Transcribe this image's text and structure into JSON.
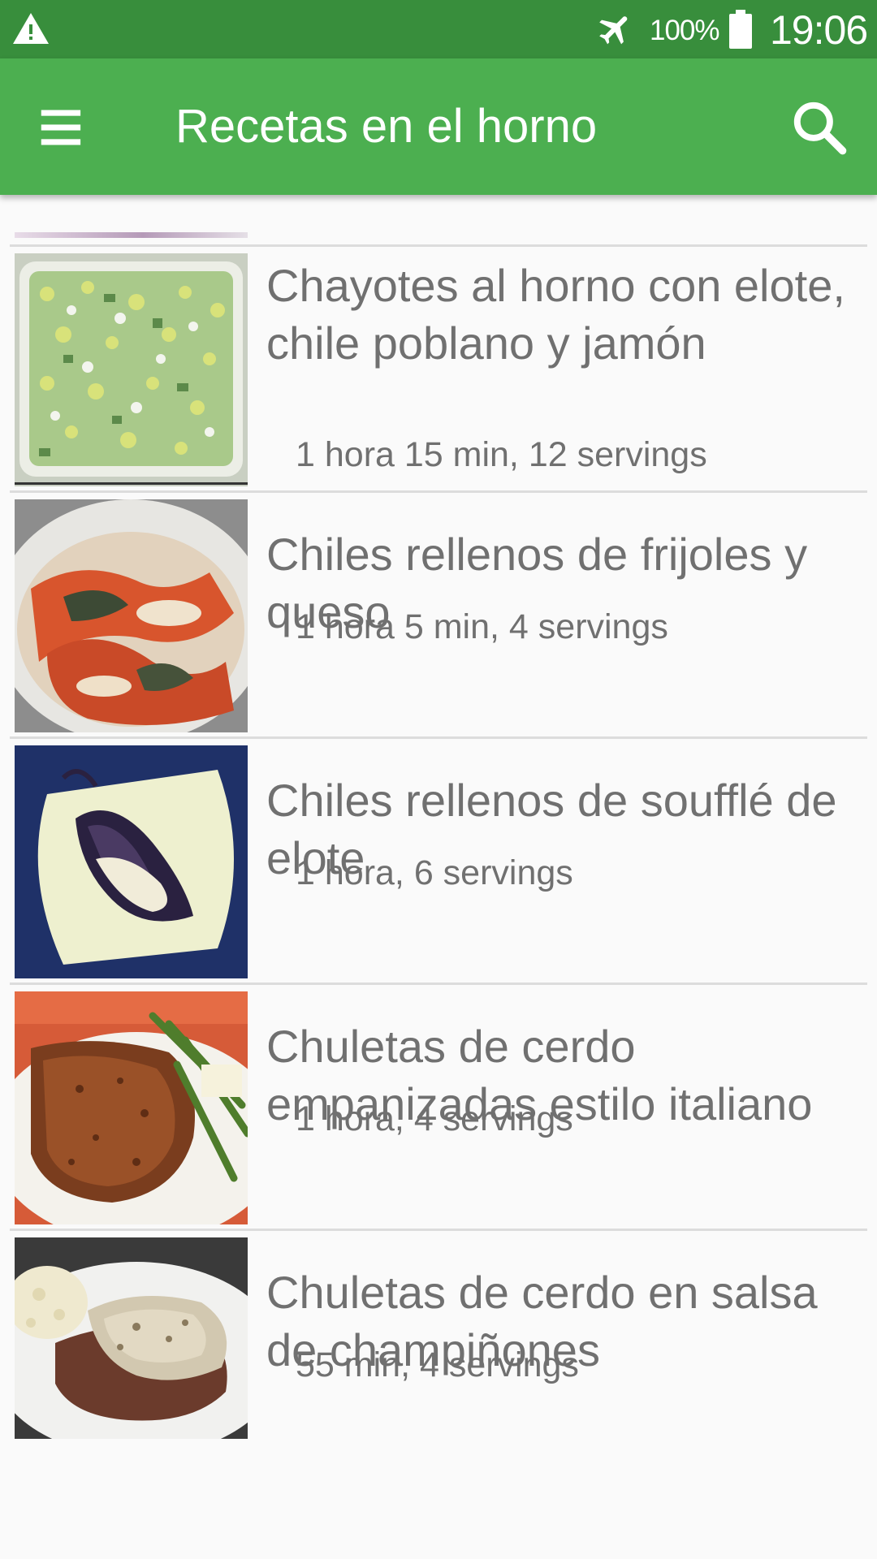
{
  "status_bar": {
    "warning_icon": "warning-icon",
    "airplane_icon": "airplane-mode-icon",
    "battery_icon": "battery-icon",
    "battery_percent": "100%",
    "time": "19:06"
  },
  "app_bar": {
    "menu_icon": "menu-icon",
    "title": "Recetas en el horno",
    "search_icon": "search-icon",
    "color": "#4caf50",
    "status_color": "#388e3c"
  },
  "recipes": [
    {
      "title": "Chayotes al horno con elote, chile poblano y jamón",
      "meta": "1 hora 15 min, 12 servings"
    },
    {
      "title": "Chiles rellenos de frijoles y queso",
      "meta": "1 hora 5 min, 4 servings"
    },
    {
      "title": "Chiles rellenos de soufflé de elote",
      "meta": "1 hora, 6 servings"
    },
    {
      "title": "Chuletas de cerdo empanizadas estilo italiano",
      "meta": "1 hora, 4 servings"
    },
    {
      "title": "Chuletas de cerdo en salsa de champiñones",
      "meta": "55 min, 4 servings"
    }
  ]
}
